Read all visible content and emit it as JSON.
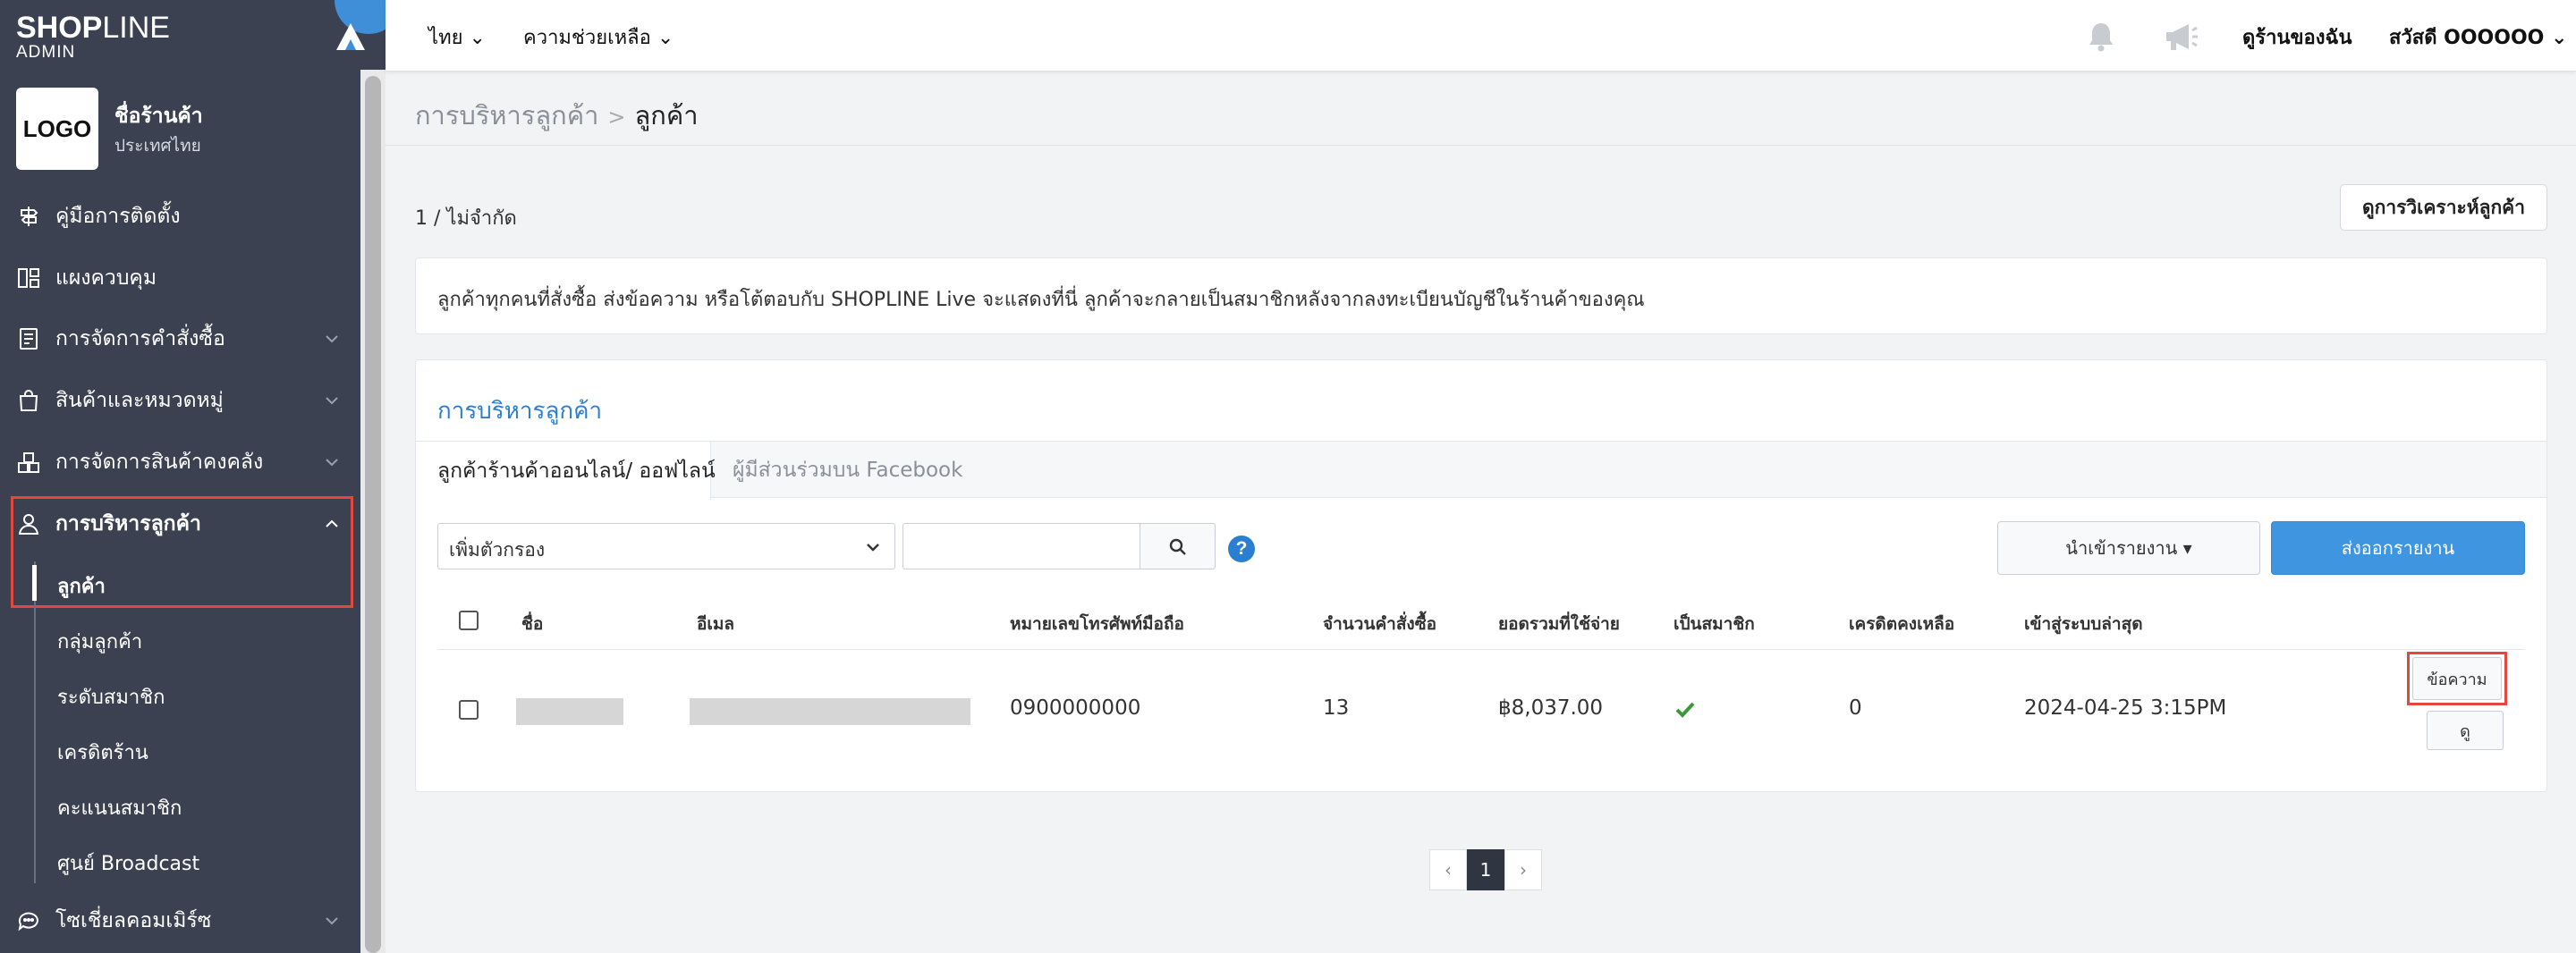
{
  "brand": {
    "name_bold": "SHOP",
    "name_thin": "LINE",
    "sub": "ADMIN"
  },
  "store": {
    "logo_text": "LOGO",
    "name": "ชื่อร้านค้า",
    "country": "ประเทศไทย"
  },
  "sidebar": {
    "items": [
      {
        "label": "คู่มือการติดตั้ง",
        "icon": "signpost-icon"
      },
      {
        "label": "แผงควบคุม",
        "icon": "dashboard-icon"
      },
      {
        "label": "การจัดการคำสั่งซื้อ",
        "icon": "order-list-icon"
      },
      {
        "label": "สินค้าและหมวดหมู่",
        "icon": "shopping-bag-icon"
      },
      {
        "label": "การจัดการสินค้าคงคลัง",
        "icon": "warehouse-icon"
      },
      {
        "label": "การบริหารลูกค้า",
        "icon": "user-icon"
      },
      {
        "label": "โซเชี่ยลคอมเมิร์ซ",
        "icon": "chat-bubble-icon"
      }
    ],
    "sub_items": [
      "ลูกค้า",
      "กลุ่มลูกค้า",
      "ระดับสมาชิก",
      "เครดิตร้าน",
      "คะแนนสมาชิก",
      "ศูนย์ Broadcast"
    ]
  },
  "topbar": {
    "language": "ไทย",
    "help": "ความช่วยเหลือ",
    "view_store": "ดูร้านของฉัน",
    "greeting": "สวัสดี OOOOOO"
  },
  "breadcrumb": {
    "parent": "การบริหารลูกค้า",
    "separator": ">",
    "current": "ลูกค้า"
  },
  "page": {
    "count_text": "1 / ไม่จำกัด",
    "analysis_button": "ดูการวิเคราะห์ลูกค้า",
    "info_text": "ลูกค้าทุกคนที่สั่งซื้อ ส่งข้อความ หรือโต้ตอบกับ SHOPLINE Live จะแสดงที่นี่ ลูกค้าจะกลายเป็นสมาชิกหลังจากลงทะเบียนบัญชีในร้านค้าของคุณ",
    "panel_title": "การบริหารลูกค้า",
    "tabs": [
      "ลูกค้าร้านค้าออนไลน์/ ออฟไลน์",
      "ผู้มีส่วนร่วมบน Facebook"
    ],
    "filter_label": "เพิ่มตัวกรอง",
    "search_value": "",
    "help_glyph": "?",
    "import_button": "นำเข้ารายงาน ▾",
    "export_button": "ส่งออกรายงาน"
  },
  "table": {
    "columns": [
      "ชื่อ",
      "อีเมล",
      "หมายเลขโทรศัพท์มือถือ",
      "จำนวนคำสั่งซื้อ",
      "ยอดรวมที่ใช้จ่าย",
      "เป็นสมาชิก",
      "เครดิตคงเหลือ",
      "เข้าสู่ระบบล่าสุด"
    ],
    "rows": [
      {
        "phone": "0900000000",
        "orders": "13",
        "total": "฿8,037.00",
        "member": true,
        "credit": "0",
        "last_login": "2024-04-25 3:15PM"
      }
    ],
    "message_button": "ข้อความ",
    "view_button": "ดู"
  },
  "pagination": {
    "prev": "‹",
    "current": "1",
    "next": "›"
  },
  "colors": {
    "sidebar_bg": "#3b4150",
    "accent_blue": "#3f95e0",
    "link_blue": "#2b7fd0",
    "highlight_red": "#e2483d",
    "check_green": "#3a9a3a"
  }
}
